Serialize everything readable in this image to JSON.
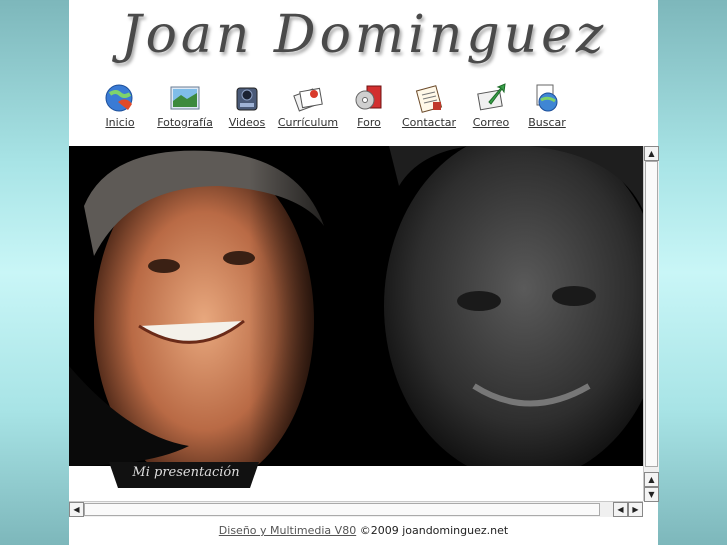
{
  "site": {
    "logo_text": "Joan Dominguez"
  },
  "nav": {
    "items": [
      {
        "label": "Inicio",
        "icon": "globe-refresh-icon"
      },
      {
        "label": "Fotografía",
        "icon": "landscape-photo-icon"
      },
      {
        "label": "Videos",
        "icon": "video-camera-icon"
      },
      {
        "label": "Currículum",
        "icon": "documents-icon"
      },
      {
        "label": "Foro",
        "icon": "forum-cd-icon"
      },
      {
        "label": "Contactar",
        "icon": "notepad-icon"
      },
      {
        "label": "Correo",
        "icon": "mail-arrow-icon"
      },
      {
        "label": "Buscar",
        "icon": "search-globe-icon"
      }
    ]
  },
  "presentation": {
    "caption": "Mi presentación"
  },
  "footer": {
    "link": "Diseño y Multimedia V80",
    "copyright": "©2009 joandominguez.net"
  },
  "colors": {
    "side_gradient": "#a8e4e6",
    "page_bg": "#ffffff",
    "photo_bg": "#000000"
  }
}
